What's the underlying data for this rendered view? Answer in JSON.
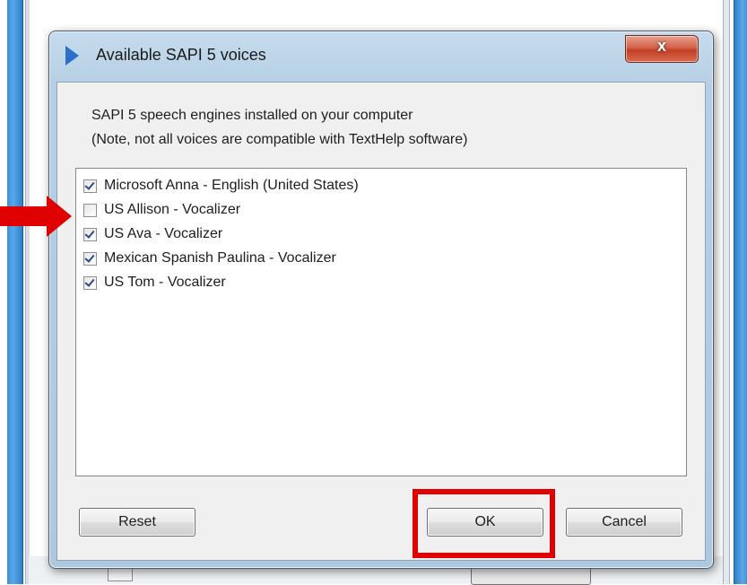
{
  "dialog": {
    "title": "Available SAPI 5 voices",
    "close_label": "x",
    "description_line1": "SAPI 5 speech engines installed on your computer",
    "description_line2": "(Note, not all voices are compatible with TextHelp software)",
    "voices": [
      {
        "label": "Microsoft Anna - English (United States)",
        "checked": true
      },
      {
        "label": "US Allison - Vocalizer",
        "checked": false
      },
      {
        "label": "US Ava - Vocalizer",
        "checked": true
      },
      {
        "label": "Mexican Spanish Paulina - Vocalizer",
        "checked": true
      },
      {
        "label": "US Tom - Vocalizer",
        "checked": true
      }
    ],
    "buttons": {
      "reset": "Reset",
      "ok": "OK",
      "cancel": "Cancel"
    }
  },
  "annotations": {
    "arrow_color": "#e00000",
    "highlight_color": "#e00000"
  },
  "colors": {
    "title_icon": "#2a6fc9",
    "close_button": "#c24025"
  }
}
